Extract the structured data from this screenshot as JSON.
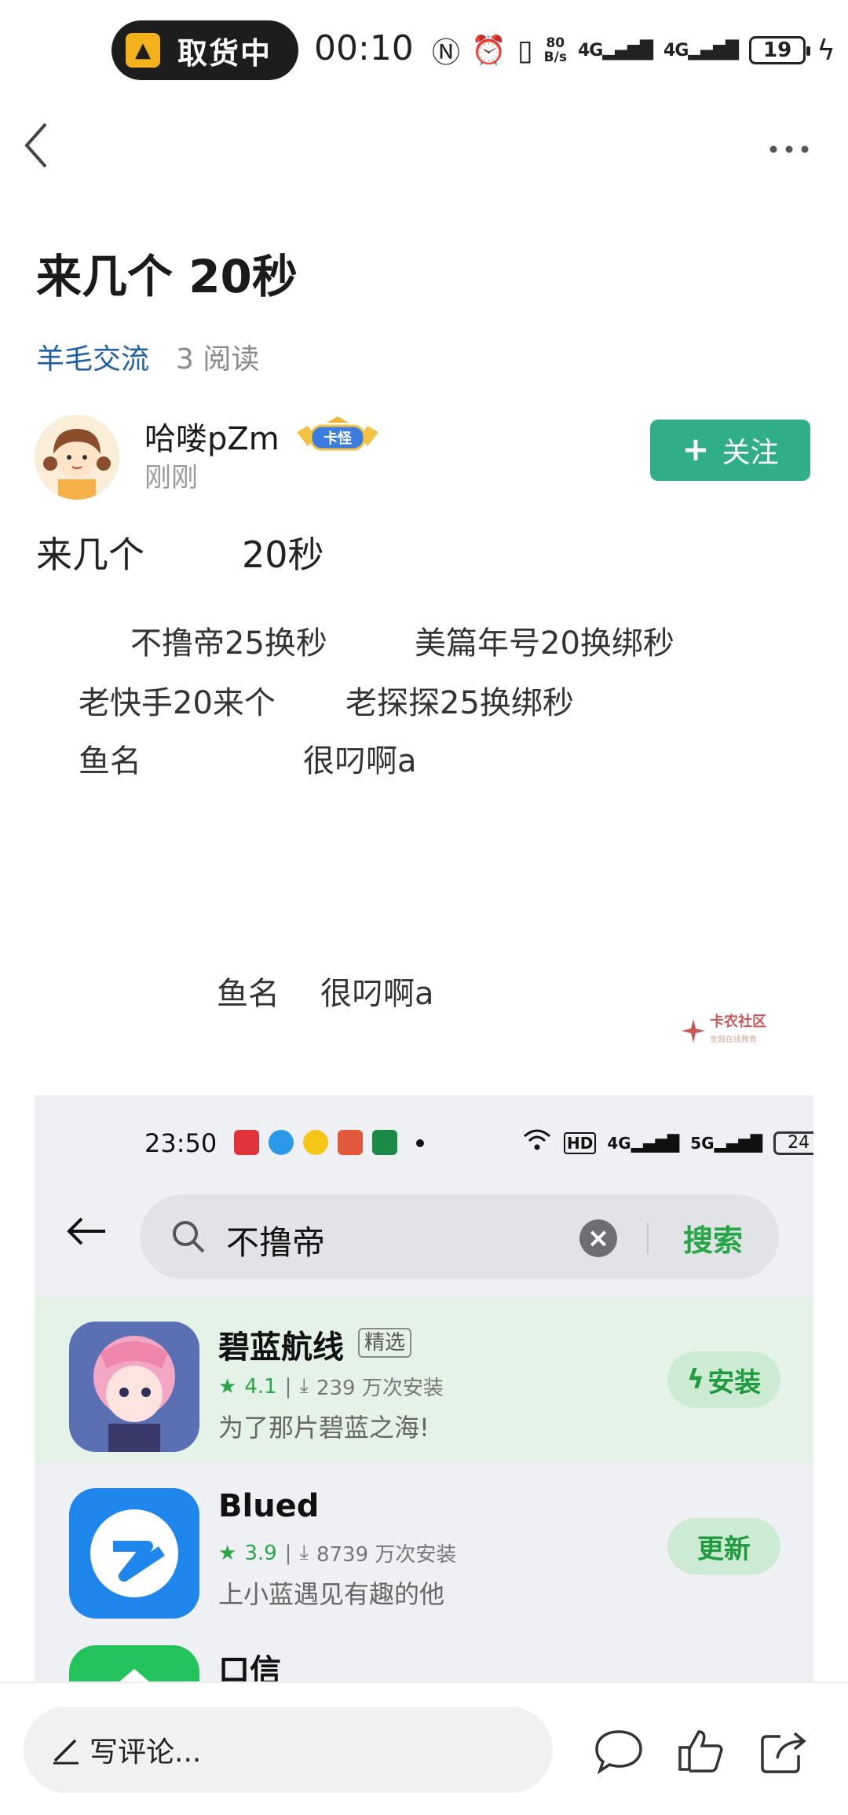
{
  "status_bar": {
    "pill_text": "取货中",
    "time": "00:10",
    "net_speed_top": "80",
    "net_speed_bottom": "B/s",
    "sig1": "4G",
    "sig2": "4G",
    "battery": "19"
  },
  "post": {
    "title": "来几个 20秒",
    "category": "羊毛交流",
    "reads": "3 阅读",
    "author_name": "哈喽pZm",
    "author_badge": "卡怪",
    "author_time": "刚刚",
    "follow_label": "关注",
    "body_line_1a": "来几个",
    "body_line_1b": "20秒",
    "items": [
      "不撸帝25换秒",
      "美篇年号20换绑秒",
      "老快手20来个",
      "老探探25换绑秒",
      "鱼名",
      "很叼啊a"
    ],
    "footer_a": "鱼名",
    "footer_b": "很叼啊a",
    "watermark_title": "卡农社区",
    "watermark_sub": "金融在线教育"
  },
  "embedded": {
    "time": "23:50",
    "hd": "HD",
    "sig1": "4G",
    "sig2": "5G",
    "battery": "24",
    "search_value": "不撸帝",
    "search_button": "搜索",
    "apps": [
      {
        "name": "碧蓝航线",
        "tag": "精选",
        "rating": "4.1",
        "installs": "239 万次安装",
        "desc": "为了那片碧蓝之海!",
        "button": "安装"
      },
      {
        "name": "Blued",
        "tag": "",
        "rating": "3.9",
        "installs": "8739 万次安装",
        "desc": "上小蓝遇见有趣的他",
        "button": "更新"
      },
      {
        "name": "口信",
        "tag": "",
        "rating": "",
        "installs": "",
        "desc": "",
        "button": ""
      }
    ]
  },
  "bottom_bar": {
    "comment_placeholder": "写评论..."
  },
  "colors": {
    "accent_green": "#2fae87",
    "category_blue": "#1f5fa8",
    "store_green": "#26a647"
  }
}
